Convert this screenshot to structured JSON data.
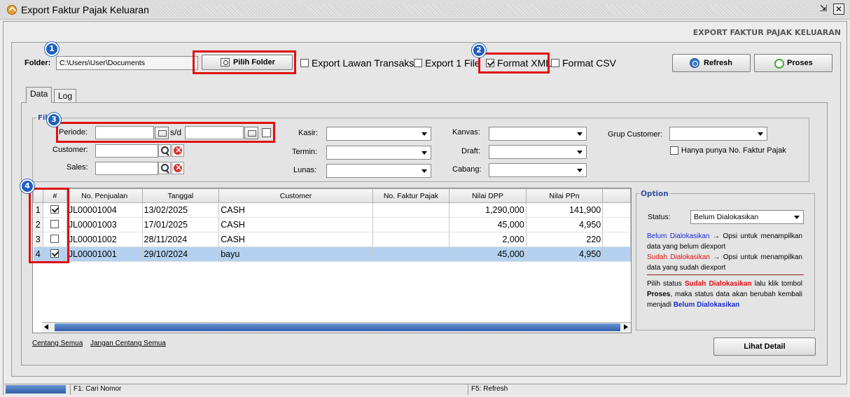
{
  "window": {
    "title": "Export Faktur Pajak Keluaran"
  },
  "header": {
    "title": "EXPORT FAKTUR PAJAK KELUARAN"
  },
  "toolbar": {
    "folder_label": "Folder:",
    "folder_value": "C:\\Users\\User\\Documents",
    "pilih_folder": "Pilih Folder",
    "export_lawan": "Export Lawan Transaksi",
    "export_lawan_checked": false,
    "export_one": "Export 1 File",
    "export_one_checked": false,
    "format_xml": "Format XML",
    "format_xml_checked": true,
    "format_csv": "Format CSV",
    "format_csv_checked": false,
    "refresh": "Refresh",
    "proses": "Proses"
  },
  "markers": [
    "1",
    "2",
    "3",
    "4"
  ],
  "tabs": [
    {
      "label": "Data",
      "active": true
    },
    {
      "label": "Log",
      "active": false
    }
  ],
  "filter": {
    "title": "Fil",
    "periode": "Periode:",
    "sd": "s/d",
    "customer": "Customer:",
    "sales": "Sales:",
    "kasir": "Kasir:",
    "termin": "Termin:",
    "lunas": "Lunas:",
    "kanvas": "Kanvas:",
    "draft": "Draft:",
    "cabang": "Cabang:",
    "grup_customer": "Grup Customer:",
    "hanya_punya": "Hanya punya No. Faktur Pajak"
  },
  "grid": {
    "columns": [
      "#",
      "No. Penjualan",
      "Tanggal",
      "Customer",
      "No. Faktur Pajak",
      "Nilai DPP",
      "Nilai PPn"
    ],
    "rows": [
      {
        "rn": "1",
        "checked": true,
        "no": "JL00001004",
        "tanggal": "13/02/2025",
        "customer": "CASH",
        "faktur": "",
        "dpp": "1,290,000",
        "ppn": "141,900",
        "selected": false
      },
      {
        "rn": "2",
        "checked": false,
        "no": "JL00001003",
        "tanggal": "17/01/2025",
        "customer": "CASH",
        "faktur": "",
        "dpp": "45,000",
        "ppn": "4,950",
        "selected": false
      },
      {
        "rn": "3",
        "checked": false,
        "no": "JL00001002",
        "tanggal": "28/11/2024",
        "customer": "CASH",
        "faktur": "",
        "dpp": "2,000",
        "ppn": "220",
        "selected": false
      },
      {
        "rn": "4",
        "checked": true,
        "no": "JL00001001",
        "tanggal": "29/10/2024",
        "customer": "bayu",
        "faktur": "",
        "dpp": "45,000",
        "ppn": "4,950",
        "selected": true
      }
    ]
  },
  "links": {
    "centang_semua": "Centang Semua",
    "jangan_centang": "Jangan Centang Semua"
  },
  "option": {
    "title": "Option",
    "status_label": "Status:",
    "status_value": "Belum Dialokasikan",
    "belum_term": "Belum Dialokasikan",
    "belum_desc": " → Opsi untuk menampilkan data yang belum diexport",
    "sudah_term": "Sudah Dialokasikan",
    "sudah_desc": " → Opsi untuk menampilkan data yang sudah diexport",
    "note_1": "Pilih status ",
    "note_sudah": "Sudah Dialokasikan",
    "note_2": " lalu klik tombol ",
    "note_proses": "Proses",
    "note_3": ", maka status data akan berubah kembali menjadi ",
    "note_belum": "Belum Dialokasikan"
  },
  "lihat_detail": "Lihat Detail",
  "statusbar": {
    "f1": "F1: Cari Nomor",
    "f5": "F5: Refresh"
  }
}
